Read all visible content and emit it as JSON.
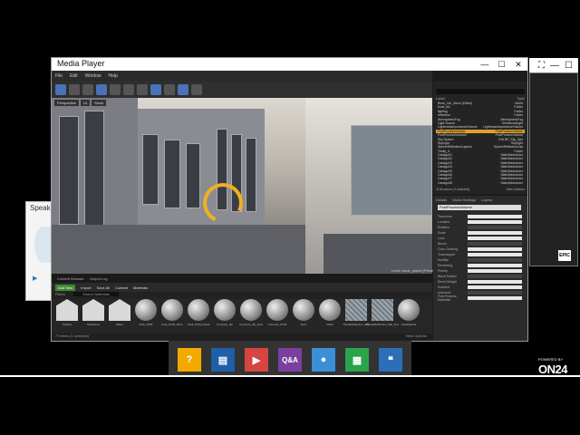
{
  "background_window": {
    "controls": [
      "⛶",
      "—",
      "☐"
    ],
    "badge": "EPIC"
  },
  "speaker_panel": {
    "label": "Speake",
    "play_icon": "play-icon"
  },
  "media_player": {
    "title": "Media Player",
    "controls": {
      "minimize": "—",
      "maximize": "☐",
      "close": "✕"
    }
  },
  "unreal": {
    "menu": [
      "File",
      "Edit",
      "Window",
      "Help"
    ],
    "viewport_buttons": [
      "Perspective",
      "Lit",
      "Show"
    ],
    "level_label": "Level: book_model (Persistent)",
    "content_browser": {
      "tabs": [
        "Content Browser",
        "Output Log"
      ],
      "add_new": "Add New",
      "import": "Import",
      "save_all": "Save All",
      "path": [
        "Content",
        "Materials"
      ],
      "filters": "Filters",
      "search_placeholder": "Search Materials",
      "assets": [
        "Default",
        "Substance",
        "Water",
        "brick_POM",
        "brick_POM_Worn",
        "brick_POM_Detail",
        "Concrete_dkr",
        "Concrete_dkr_dmd",
        "Concrete_POM",
        "Floor",
        "Metal",
        "PlanarReflection_Mat",
        "PlanarReflection_Mat_Inst",
        "NewMaterial"
      ],
      "footer_left": "77 items (1 selected)",
      "footer_right": "View Options"
    },
    "outliner": {
      "header_label": "Label",
      "header_type": "Type",
      "rows": [
        {
          "label": "Book_Lsh_Demo (Editor)",
          "type": "World"
        },
        {
          "label": "book_lsh",
          "type": "Folder"
        },
        {
          "label": "lighting",
          "type": "Folder"
        },
        {
          "label": "reflection",
          "type": "Folder"
        },
        {
          "label": "AtmosphericFog",
          "type": "AtmosphericFog"
        },
        {
          "label": "Light Source",
          "type": "DirectionalLight"
        },
        {
          "label": "LightmassImportanceVolume",
          "type": "LightmassImportanceVolume"
        },
        {
          "label": "PostProcessVolume",
          "type": "PostProcessVolume"
        },
        {
          "label": "PostProcessVolume2",
          "type": "PostProcessVolume"
        },
        {
          "label": "Sky Sphere",
          "type": "Edit BP_Sky_Sph"
        },
        {
          "label": "SkyLight",
          "type": "SkyLight"
        },
        {
          "label": "SphereReflectionCapture",
          "type": "SphereReflectionCap"
        },
        {
          "label": "Trinity_it",
          "type": "Folder"
        },
        {
          "label": "Cartago01",
          "type": "StaticMeshActor"
        },
        {
          "label": "Cartago02",
          "type": "StaticMeshActor"
        },
        {
          "label": "Cartago03",
          "type": "StaticMeshActor"
        },
        {
          "label": "Cartago04",
          "type": "StaticMeshActor"
        },
        {
          "label": "Cartago05",
          "type": "StaticMeshActor"
        },
        {
          "label": "Cartago06",
          "type": "StaticMeshActor"
        },
        {
          "label": "Cartago07",
          "type": "StaticMeshActor"
        },
        {
          "label": "Cartago08",
          "type": "StaticMeshActor"
        }
      ],
      "selected_index": 7,
      "foot_left": "1136 actors (1 selected)",
      "foot_right": "View Options"
    },
    "details": {
      "tabs": [
        "Details",
        "World Settings",
        "Layers"
      ],
      "name": "PostProcessVolume",
      "rows": [
        "Transform",
        "Location",
        "Rotation",
        "Scale",
        "Lens",
        "Bloom",
        "Color Grading",
        "Tonemapper",
        "Mobility",
        "Rendering",
        "Priority",
        "Blend Radius",
        "Blend Weight",
        "Enabled",
        "Unbound",
        "Post Process Materials"
      ]
    }
  },
  "dock": {
    "items": [
      {
        "name": "help-icon",
        "glyph": "?",
        "color": "#f2a900"
      },
      {
        "name": "slides-icon",
        "glyph": "▤",
        "color": "#1f5fa8"
      },
      {
        "name": "media-icon",
        "glyph": "▶",
        "color": "#d64541"
      },
      {
        "name": "qa-icon",
        "glyph": "Q&A",
        "color": "#7b3fa0"
      },
      {
        "name": "speaker-bio-icon",
        "glyph": "●",
        "color": "#3a8fd6"
      },
      {
        "name": "resources-icon",
        "glyph": "▦",
        "color": "#2aa34a"
      },
      {
        "name": "chat-icon",
        "glyph": "❝",
        "color": "#2a6fb8"
      }
    ]
  },
  "branding": {
    "powered_by": "POWERED BY",
    "name": "ON24"
  }
}
